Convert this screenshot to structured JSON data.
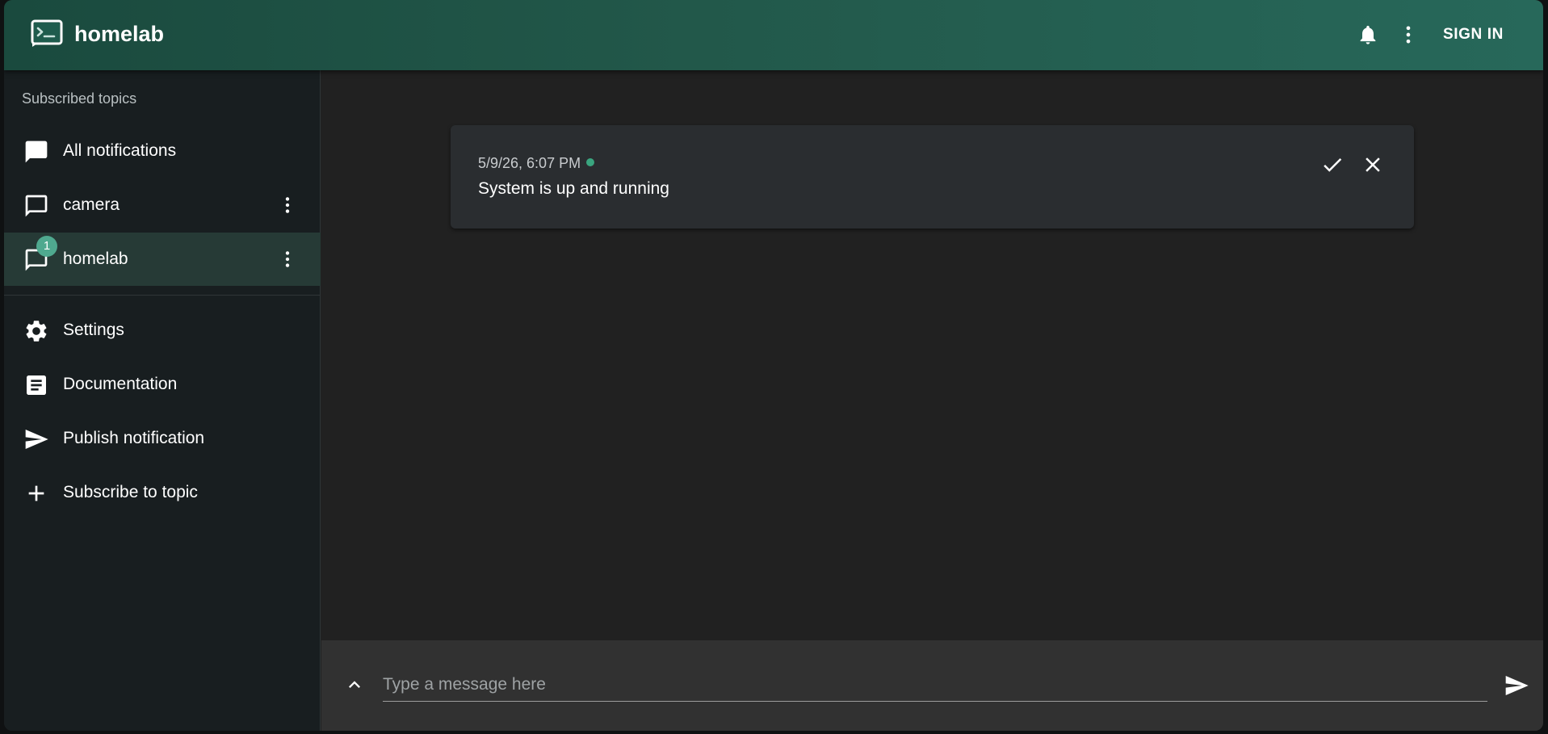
{
  "header": {
    "title": "homelab",
    "logo_icon": "terminal-icon",
    "sign_in_label": "SIGN IN",
    "accent_color": "#3fb49a"
  },
  "sidebar": {
    "heading": "Subscribed topics",
    "topics": [
      {
        "label": "All notifications",
        "icon": "chat-filled-icon"
      },
      {
        "label": "camera",
        "icon": "chat-outline-icon"
      },
      {
        "label": "homelab",
        "icon": "chat-outline-icon",
        "badge": "1"
      }
    ],
    "actions": [
      {
        "label": "Settings",
        "icon": "gear-icon"
      },
      {
        "label": "Documentation",
        "icon": "document-icon"
      },
      {
        "label": "Publish notification",
        "icon": "send-icon"
      },
      {
        "label": "Subscribe to topic",
        "icon": "plus-icon"
      }
    ]
  },
  "notification": {
    "timestamp": "5/9/26, 6:07 PM",
    "message": "System is up and running",
    "unread_dot_color": "#3aa57f"
  },
  "composer": {
    "placeholder": "Type a message here"
  }
}
